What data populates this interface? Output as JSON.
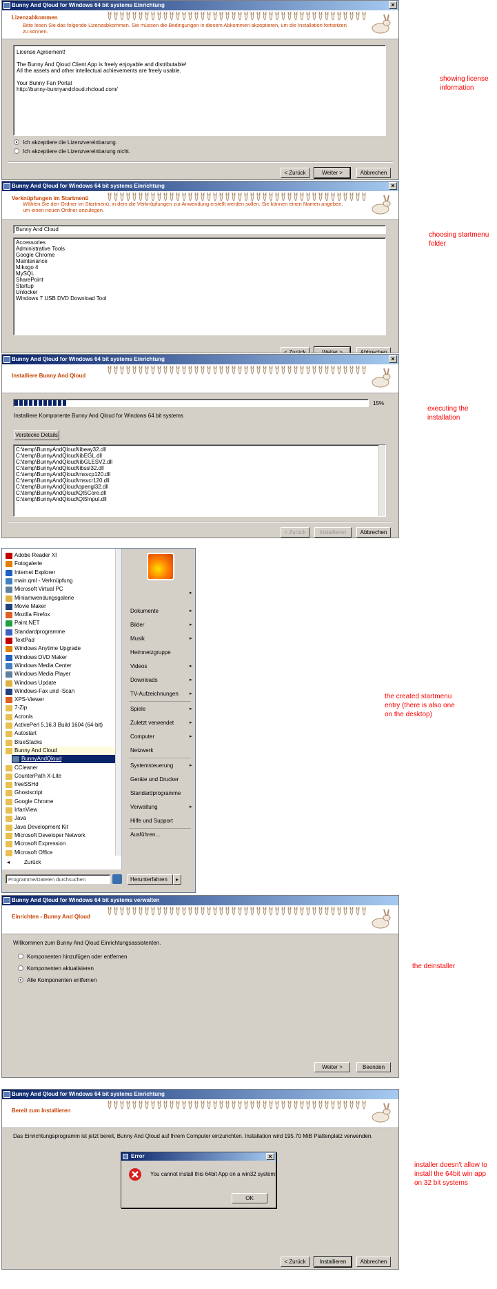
{
  "colors": {
    "title_blue": "#0a246a",
    "header_orange": "#c84000",
    "note_red": "#ff0000",
    "selected": "#0a246a"
  },
  "notes": {
    "license": "showing license\ninformation",
    "startmenu_folder": "choosing startmenu\nfolder",
    "installing": "executing the\ninstallation",
    "startmenu_entry": "the created startmenu\nentry (there is also one\non the desktop)",
    "deinstaller": "the deinstaller",
    "error": "installer doesn't allow to\ninstall the 64bit win app\non 32 bit systems"
  },
  "p1": {
    "title": "Bunny And Qloud for Windows 64 bit systems Einrichtung",
    "hdr": "Lizenzabkommen",
    "sub": "Bitte lesen Sie das folgende Lizenzabkommen. Sie müssen die Bedingungen in diesem Abkommen akzeptieren, um die Installation fortsetzen zu können.",
    "license_lines": [
      "License Agreement!",
      "",
      "The Bunny And Qloud Client App is freely enjoyable and distributable!",
      "All the assets and other intellectual achievements are freely usable.",
      "",
      "Your Bunny Fan Portal",
      "http://bunny-bunnyandcloud.rhcloud.com/"
    ],
    "accept": "Ich akzeptiere die Lizenzvereinbarung.",
    "decline": "Ich akzeptiere die Lizenzvereinbarung nicht.",
    "back": "< Zurück",
    "next": "Weiter >",
    "cancel": "Abbrechen"
  },
  "p2": {
    "title": "Bunny And Qloud for Windows 64 bit systems Einrichtung",
    "hdr": "Verknüpfungen im Startmenü",
    "sub": "Wählen Sie den Ordner im Startmenü, in dem die Verknüpfungen zur Anwendung erstellt werden sollen. Sie können einen Namen angeben, um einen neuen Ordner anzulegen.",
    "folder_value": "Bunny And Cloud",
    "folders": [
      "Accessories",
      "Administrative Tools",
      "Google Chrome",
      "Maintenance",
      "Mikogo 4",
      "MySQL",
      "SharePoint",
      "Startup",
      "Unlocker",
      "Windows 7 USB DVD Download Tool"
    ],
    "back": "< Zurück",
    "next": "Weiter >",
    "cancel": "Abbrechen"
  },
  "p3": {
    "title": "Bunny And Qloud for Windows 64 bit systems Einrichtung",
    "hdr": "Installiere Bunny And Qloud",
    "progress_pct": 15,
    "progress_label": "15%",
    "status": "Installiere Komponente Bunny And Qloud for Windows 64 bit systems",
    "details_btn": "Verstecke Details",
    "files": [
      "C:\\temp\\BunnyAndQloud\\libeay32.dll",
      "C:\\temp\\BunnyAndQloud\\libEGL.dll",
      "C:\\temp\\BunnyAndQloud\\libGLESV2.dll",
      "C:\\temp\\BunnyAndQloud\\libssl32.dll",
      "C:\\temp\\BunnyAndQloud\\msvcp120.dll",
      "C:\\temp\\BunnyAndQloud\\msvcr120.dll",
      "C:\\temp\\BunnyAndQloud\\opengl32.dll",
      "C:\\temp\\BunnyAndQloud\\Qt5Core.dll",
      "C:\\temp\\BunnyAndQloud\\Qt5Input.dll"
    ],
    "back": "< Zurück",
    "install": "Installieren",
    "cancel": "Abbrechen"
  },
  "startmenu": {
    "programs": [
      "Adobe Reader XI",
      "Fotogalerie",
      "Internet Explorer",
      "main.qml - Verknüpfung",
      "Microsoft Virtual PC",
      "Miniamwendungsgalerie",
      "Movie Maker",
      "Mozilla Firefox",
      "Paint.NET",
      "Standardprogramme",
      "TextPad",
      "Windows Anytime Upgrade",
      "Windows DVD Maker",
      "Windows Media Center",
      "Windows Media Player",
      "Windows Update",
      "Windows-Fax und -Scan",
      "XPS-Viewer",
      "7-Zip",
      "Acronis",
      "ActivePerl 5.16.3 Build 1604 (64-bit)",
      "Autostart",
      "BlueStacks",
      "Bunny And Cloud",
      "BunnyAndQloud",
      "CCleaner",
      "CounterPath X-Lite",
      "freeSSHd",
      "Ghostscript",
      "Google Chrome",
      "IrfanView",
      "Java",
      "Java Development Kit",
      "Microsoft Developer Network",
      "Microsoft Expression",
      "Microsoft Office"
    ],
    "back": "Zurück",
    "search_placeholder": "Programme/Dateien durchsuchen",
    "right": [
      {
        "label": "Dokumente",
        "arrow": true
      },
      {
        "label": "Bilder",
        "arrow": true
      },
      {
        "label": "Musik",
        "arrow": true
      },
      {
        "label": "Heimnetzgruppe",
        "arrow": false
      },
      {
        "label": "Videos",
        "arrow": true
      },
      {
        "label": "Downloads",
        "arrow": true
      },
      {
        "label": "TV-Aufzeichnungen",
        "arrow": true
      },
      {
        "label": "Spiele",
        "arrow": true
      },
      {
        "label": "Zuletzt verwendet",
        "arrow": true
      },
      {
        "label": "Computer",
        "arrow": true
      },
      {
        "label": "Netzwerk",
        "arrow": false
      },
      {
        "label": "Systemsteuerung",
        "arrow": true
      },
      {
        "label": "Geräte und Drucker",
        "arrow": false
      },
      {
        "label": "Standardprogramme",
        "arrow": false
      },
      {
        "label": "Verwaltung",
        "arrow": true
      },
      {
        "label": "Hilfe und Support",
        "arrow": false
      },
      {
        "label": "Ausführen...",
        "arrow": false
      }
    ],
    "shutdown": "Herunterfahren"
  },
  "p5": {
    "title": "Bunny And Qloud for Windows 64 bit systems verwalten",
    "hdr": "Einrichten - Bunny And Qloud",
    "welcome": "Willkommen zum Bunny And Qloud Einrichtungsassistenten.",
    "options": [
      "Komponenten hinzufügen oder entfernen",
      "Komponenten aktualisieren",
      "Alle Komponenten entfernen"
    ],
    "next": "Weiter >",
    "quit": "Beenden"
  },
  "p6": {
    "title": "Bunny And Qloud for Windows 64 bit systems Einrichtung",
    "hdr": "Bereit zum Installieren",
    "ready": "Das Einrichtungsprogramm ist jetzt bereit, Bunny And Qloud auf Ihrem Computer einzurichten. Installation wird 195.70 MiB Plattenplatz verwenden.",
    "error_title": "Error",
    "error_msg": "You cannot install this 64bit App on a win32 system!",
    "ok": "OK",
    "back": "< Zurück",
    "install": "Installieren",
    "cancel": "Abbrechen"
  }
}
